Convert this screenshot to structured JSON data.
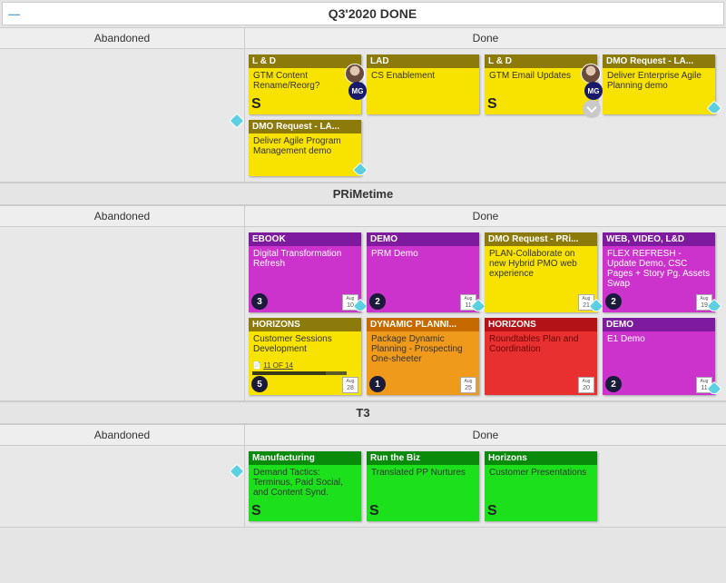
{
  "top": {
    "collapse_glyph": "—",
    "title": "Q3'2020 DONE"
  },
  "columns": {
    "abandoned": "Abandoned",
    "done": "Done"
  },
  "sections": {
    "q3": {
      "done": [
        {
          "hdr": "L & D",
          "body": "GTM Content Rename/Reorg?",
          "hdrClass": "hdr-olive",
          "bodyClass": "body-yellow",
          "avatar": true,
          "mg": "MG",
          "s": true
        },
        {
          "hdr": "LAD",
          "body": "CS Enablement",
          "hdrClass": "hdr-olive",
          "bodyClass": "body-yellow"
        },
        {
          "hdr": "L & D",
          "body": "GTM Email Updates",
          "hdrClass": "hdr-olive",
          "bodyClass": "body-yellow",
          "avatar": true,
          "mg": "MG",
          "s": true,
          "chevron": true
        },
        {
          "hdr": "DMO Request - LA...",
          "body": "Deliver Enterprise Agile Planning demo",
          "hdrClass": "hdr-olive",
          "bodyClass": "body-yellow",
          "tag": true
        },
        {
          "hdr": "DMO Request - LA...",
          "body": "Deliver Agile Program Management demo",
          "hdrClass": "hdr-olive",
          "bodyClass": "body-yellow",
          "tag": true
        }
      ]
    },
    "primetime": {
      "title": "PRiMetime",
      "done": [
        {
          "hdr": "EBOOK",
          "body": "Digital Transformation Refresh",
          "hdrClass": "hdr-purple",
          "bodyClass": "body-magenta",
          "count": "3",
          "date": {
            "mo": "Aug",
            "d": "10"
          },
          "tag": true
        },
        {
          "hdr": "DEMO",
          "body": "PRM Demo",
          "hdrClass": "hdr-purple",
          "bodyClass": "body-magenta",
          "count": "2",
          "date": {
            "mo": "Aug",
            "d": "11"
          },
          "tag": true
        },
        {
          "hdr": "DMO Request - PRi...",
          "body": "PLAN-Collaborate on new Hybrid PMO web experience",
          "hdrClass": "hdr-olive",
          "bodyClass": "body-yellow",
          "date": {
            "mo": "Aug",
            "d": "21"
          },
          "tag": true
        },
        {
          "hdr": "WEB, VIDEO, L&D",
          "body": "FLEX REFRESH - Update Demo, CSC Pages + Story Pg. Assets Swap",
          "hdrClass": "hdr-purple",
          "bodyClass": "body-magenta",
          "count": "2",
          "date": {
            "mo": "Aug",
            "d": "19"
          },
          "tag": true
        },
        {
          "hdr": "HORIZONS",
          "body": "Customer Sessions Development",
          "hdrClass": "hdr-olive",
          "bodyClass": "body-yellow",
          "count": "5",
          "date": {
            "mo": "Aug",
            "d": "28"
          },
          "progress": {
            "text": "11 OF 14",
            "pct": 78
          }
        },
        {
          "hdr": "DYNAMIC PLANNI...",
          "body": "Package Dynamic Planning - Prospecting One-sheeter",
          "hdrClass": "hdr-orange",
          "bodyClass": "body-orange",
          "count": "1",
          "date": {
            "mo": "Aug",
            "d": "25"
          }
        },
        {
          "hdr": "HORIZONS",
          "body": "Roundtables Plan and Coordination",
          "hdrClass": "hdr-red",
          "bodyClass": "body-red",
          "date": {
            "mo": "Aug",
            "d": "20"
          }
        },
        {
          "hdr": "DEMO",
          "body": "E1 Demo",
          "hdrClass": "hdr-purple",
          "bodyClass": "body-magenta",
          "count": "2",
          "date": {
            "mo": "Aug",
            "d": "11"
          },
          "tag": true
        }
      ]
    },
    "t3": {
      "title": "T3",
      "done": [
        {
          "hdr": "Manufacturing",
          "body": "Demand Tactics: Terminus, Paid Social, and Content Synd.",
          "hdrClass": "hdr-green",
          "bodyClass": "body-green",
          "s": true
        },
        {
          "hdr": "Run the Biz",
          "body": "Translated PP Nurtures",
          "hdrClass": "hdr-green",
          "bodyClass": "body-green",
          "s": true
        },
        {
          "hdr": "Horizons",
          "body": "Customer Presentations",
          "hdrClass": "hdr-green",
          "bodyClass": "body-green",
          "s": true
        }
      ]
    }
  }
}
